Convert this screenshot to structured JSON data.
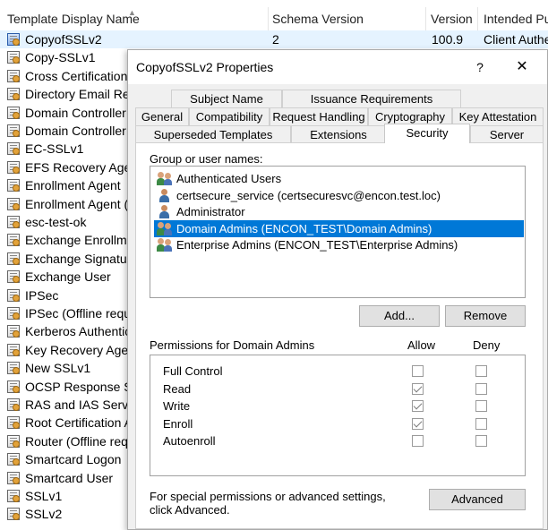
{
  "list": {
    "columns": [
      "Template Display Name",
      "Schema Version",
      "Version",
      "Intended Pu"
    ],
    "rows": [
      {
        "name": "CopyofSSLv2",
        "schema": "2",
        "version": "100.9",
        "purpose": "Client Authe",
        "selected": true
      },
      {
        "name": "Copy-SSLv1"
      },
      {
        "name": "Cross Certification A"
      },
      {
        "name": "Directory Email Rep"
      },
      {
        "name": "Domain Controller"
      },
      {
        "name": "Domain Controller"
      },
      {
        "name": "EC-SSLv1"
      },
      {
        "name": "EFS Recovery Agen"
      },
      {
        "name": "Enrollment Agent"
      },
      {
        "name": "Enrollment Agent (C"
      },
      {
        "name": "esc-test-ok"
      },
      {
        "name": "Exchange Enrollme"
      },
      {
        "name": "Exchange Signature"
      },
      {
        "name": "Exchange User"
      },
      {
        "name": "IPSec"
      },
      {
        "name": "IPSec (Offline reque"
      },
      {
        "name": "Kerberos Authentic"
      },
      {
        "name": "Key Recovery Agen"
      },
      {
        "name": "New SSLv1"
      },
      {
        "name": "OCSP Response Sig"
      },
      {
        "name": "RAS and IAS Server"
      },
      {
        "name": "Root Certification A"
      },
      {
        "name": "Router (Offline requ"
      },
      {
        "name": "Smartcard Logon"
      },
      {
        "name": "Smartcard User"
      },
      {
        "name": "SSLv1"
      },
      {
        "name": "SSLv2"
      }
    ]
  },
  "dialog": {
    "title": "CopyofSSLv2 Properties",
    "help": "?",
    "close": "✕",
    "tabs": {
      "subject_name": "Subject Name",
      "issuance": "Issuance Requirements",
      "general": "General",
      "compatibility": "Compatibility",
      "request_handling": "Request Handling",
      "cryptography": "Cryptography",
      "key_attestation": "Key Attestation",
      "superseded": "Superseded Templates",
      "extensions": "Extensions",
      "security": "Security",
      "server": "Server"
    },
    "group_label": "Group or user names:",
    "users": [
      {
        "name": "Authenticated Users",
        "icon": "group-icon"
      },
      {
        "name": "certsecure_service (certsecuresvc@encon.test.loc)",
        "icon": "user-icon"
      },
      {
        "name": "Administrator",
        "icon": "user-icon"
      },
      {
        "name": "Domain Admins (ENCON_TEST\\Domain Admins)",
        "icon": "group-icon",
        "selected": true
      },
      {
        "name": "Enterprise Admins (ENCON_TEST\\Enterprise Admins)",
        "icon": "group-icon"
      }
    ],
    "add_label": "Add...",
    "remove_label": "Remove",
    "permissions_label": "Permissions for Domain Admins",
    "allow_label": "Allow",
    "deny_label": "Deny",
    "permissions": [
      {
        "name": "Full Control",
        "allow": false,
        "deny": false
      },
      {
        "name": "Read",
        "allow": true,
        "deny": false
      },
      {
        "name": "Write",
        "allow": true,
        "deny": false
      },
      {
        "name": "Enroll",
        "allow": true,
        "deny": false
      },
      {
        "name": "Autoenroll",
        "allow": false,
        "deny": false
      }
    ],
    "special_text": "For special permissions or advanced settings, click Advanced.",
    "advanced_label": "Advanced"
  }
}
